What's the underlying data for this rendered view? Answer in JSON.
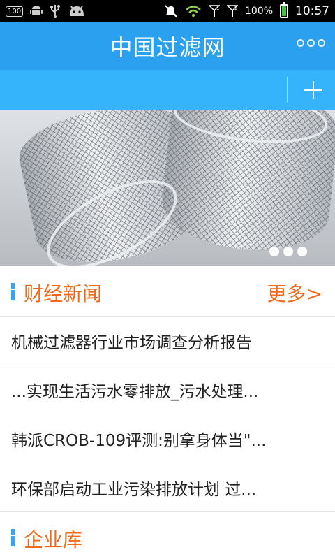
{
  "status_bar": {
    "notification_badge": "100",
    "battery_percent": "100%",
    "battery_level": 1.0,
    "time": "10:57",
    "signal1_label": "1",
    "signal2_label": "2"
  },
  "header": {
    "title": "中国过滤网"
  },
  "banner": {
    "slide_count": 3,
    "active_slide": 1
  },
  "finance_news": {
    "title": "财经新闻",
    "more_label": "更多>",
    "items": [
      "机械过滤器行业市场调查分析报告",
      "...实现生活污水零排放_污水处理...",
      "韩派CROB-109评测:别拿身体当\"...",
      "环保部启动工业污染排放计划 过..."
    ]
  },
  "enterprise": {
    "title": "企业库"
  },
  "colors": {
    "title_bar": "#2aa0ef",
    "tab_bar": "#35b3fb",
    "accent": "#f06a1a"
  }
}
